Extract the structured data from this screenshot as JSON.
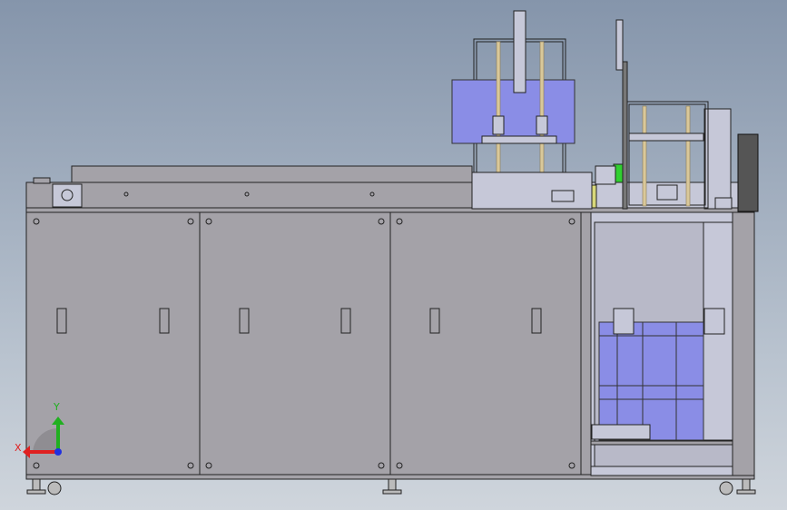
{
  "viewport": {
    "triad": {
      "x_label": "X",
      "y_label": "Y",
      "x_color": "#e02020",
      "y_color": "#20b020",
      "z_color": "#2030e0"
    }
  },
  "colors": {
    "background_top": "#8595ab",
    "panel": "#a4a2a8",
    "blue_parts": "#8a8de6"
  }
}
